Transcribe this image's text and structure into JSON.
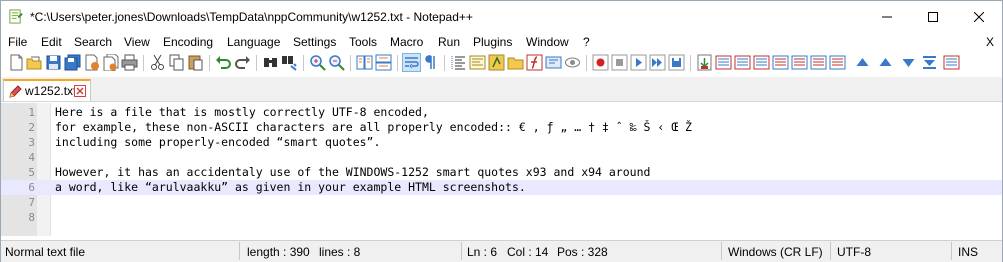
{
  "window": {
    "title": "*C:\\Users\\peter.jones\\Downloads\\TempData\\nppCommunity\\w1252.txt - Notepad++"
  },
  "menu": {
    "items": [
      "File",
      "Edit",
      "Search",
      "View",
      "Encoding",
      "Language",
      "Settings",
      "Tools",
      "Macro",
      "Run",
      "Plugins",
      "Window",
      "?"
    ],
    "close_label": "X"
  },
  "toolbar": {
    "icons": [
      "new-file-icon",
      "open-file-icon",
      "save-icon",
      "save-all-icon",
      "close-icon",
      "close-all-icon",
      "print-icon",
      "cut-icon",
      "copy-icon",
      "paste-icon",
      "undo-icon",
      "redo-icon",
      "find-icon",
      "replace-icon",
      "zoom-in-icon",
      "zoom-out-icon",
      "sync-vertical-icon",
      "sync-horizontal-icon",
      "word-wrap-icon",
      "show-all-characters-icon",
      "indent-guide-icon",
      "document-map-icon",
      "function-list-icon",
      "folder-workspace-icon",
      "monitoring-icon",
      "record-macro-icon",
      "stop-recording-icon",
      "playback-macro-icon",
      "run-macro-multiple-icon",
      "save-macro-icon",
      "plugin-a-icon",
      "plugin-b-icon",
      "plugin-c-icon",
      "plugin-d-icon",
      "move-up-icon",
      "move-down-icon",
      "plugin-e-icon",
      "plugin-f-icon"
    ]
  },
  "tab": {
    "label": "w1252.txt"
  },
  "editor": {
    "lines": [
      {
        "number": "1",
        "text": "Here is a file that is mostly correctly UTF-8 encoded,"
      },
      {
        "number": "2",
        "text": "for example, these non-ASCII characters are all properly encoded:: € , ƒ „ … † ‡ ˆ ‰ Š ‹ Œ Ž"
      },
      {
        "number": "3",
        "text": "including some properly-encoded “smart quotes”."
      },
      {
        "number": "4",
        "text": ""
      },
      {
        "number": "5",
        "text": "However, it has an accidentaly use of the WINDOWS-1252 smart quotes x93 and x94 around"
      },
      {
        "number": "6",
        "text": "a word, like “arulvaakku” as given in your example HTML screenshots."
      },
      {
        "number": "7",
        "text": ""
      },
      {
        "number": "8",
        "text": ""
      }
    ]
  },
  "status": {
    "file_type": "Normal text file",
    "length": "length : 390",
    "lines": "lines : 8",
    "ln": "Ln : 6",
    "col": "Col : 14",
    "pos": "Pos : 328",
    "eol": "Windows (CR LF)",
    "encoding": "UTF-8",
    "insert_mode": "INS"
  },
  "colors": {
    "current_line": "#e8e8ff",
    "gutter": "#e4e4e4",
    "tab_accent": "#f5a623",
    "status_bg": "#f0f0f0"
  }
}
